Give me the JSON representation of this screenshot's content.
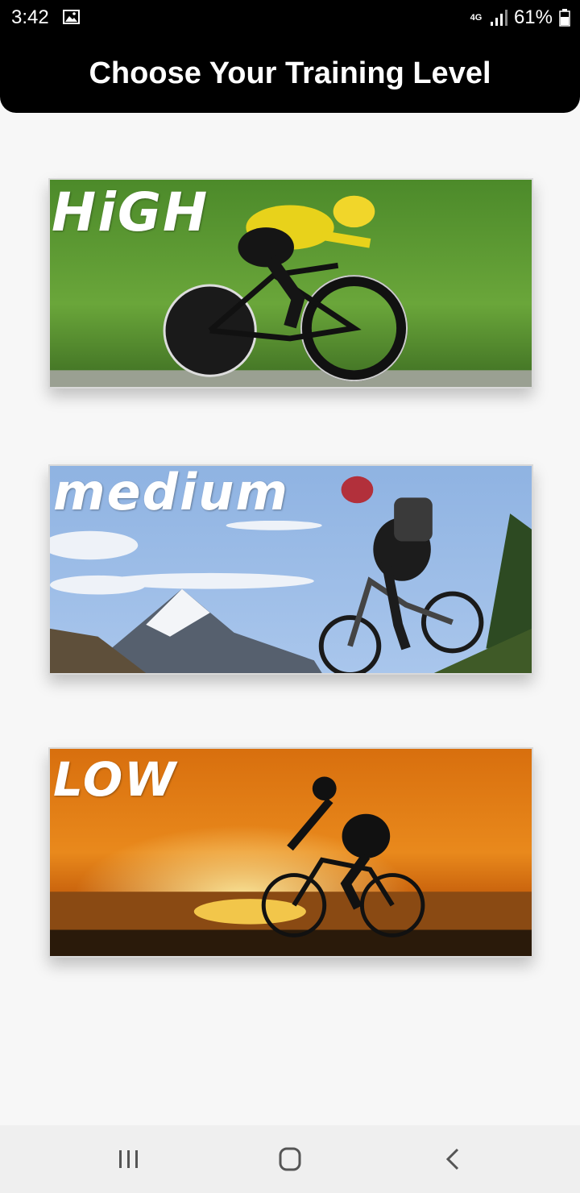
{
  "status_bar": {
    "time": "3:42",
    "network": "4G",
    "battery": "61%",
    "icons": [
      "gallery-icon",
      "signal-icon",
      "battery-icon"
    ]
  },
  "app_bar": {
    "title": "Choose Your Training Level"
  },
  "levels": [
    {
      "label": "HiGH",
      "scene": "time-trial cyclist on green grass"
    },
    {
      "label": "medium",
      "scene": "mountain biker with snowy peaks"
    },
    {
      "label": "LOW",
      "scene": "cyclist silhouette at sunset over water"
    }
  ],
  "nav_bar": {
    "icons": [
      "recent-apps-icon",
      "home-icon",
      "back-icon"
    ]
  },
  "colors": {
    "app_bar_bg": "#000000",
    "page_bg": "#f7f7f7",
    "nav_bg": "#efefef"
  }
}
